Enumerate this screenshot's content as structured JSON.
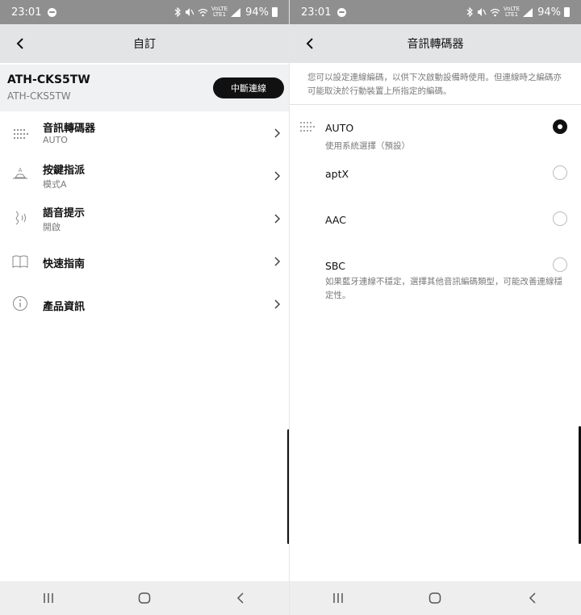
{
  "status_bar": {
    "time": "23:01",
    "network": "LTE1",
    "volte": "VoLTE",
    "battery": "94%"
  },
  "customize_screen": {
    "title": "自訂",
    "device": {
      "name": "ATH-CKS5TW",
      "model": "ATH-CKS5TW",
      "disconnect_label": "中斷連線"
    },
    "menu": [
      {
        "title": "音訊轉碼器",
        "subtitle": "AUTO",
        "icon": "codec-icon"
      },
      {
        "title": "按鍵指派",
        "subtitle": "模式A",
        "icon": "button-assign-icon"
      },
      {
        "title": "語音提示",
        "subtitle": "開啟",
        "icon": "voice-guidance-icon"
      },
      {
        "title": "快速指南",
        "subtitle": "",
        "icon": "book-icon"
      },
      {
        "title": "產品資訊",
        "subtitle": "",
        "icon": "info-icon"
      }
    ]
  },
  "codec_screen": {
    "title": "音訊轉碼器",
    "info_text": "您可以設定連線編碼，以供下次啟動設備時使用。但連線時之編碼亦可能取決於行動裝置上所指定的編碼。",
    "options": [
      {
        "label": "AUTO",
        "subtitle": "使用系統選擇（預設）",
        "selected": true
      },
      {
        "label": "aptX",
        "subtitle": "",
        "selected": false
      },
      {
        "label": "AAC",
        "subtitle": "",
        "selected": false
      },
      {
        "label": "SBC",
        "subtitle": "",
        "selected": false
      }
    ],
    "note": "如果藍牙連線不穩定，選擇其他音訊編碼類型，可能改善連線穩定性。"
  },
  "colors": {
    "status_bar": "#8f8f8f",
    "app_bar": "#e2e4e5",
    "device_bar": "#f0f1f2",
    "accent": "#111111",
    "secondary_text": "#7a7a7a",
    "nav_bar": "#eeeeee"
  }
}
